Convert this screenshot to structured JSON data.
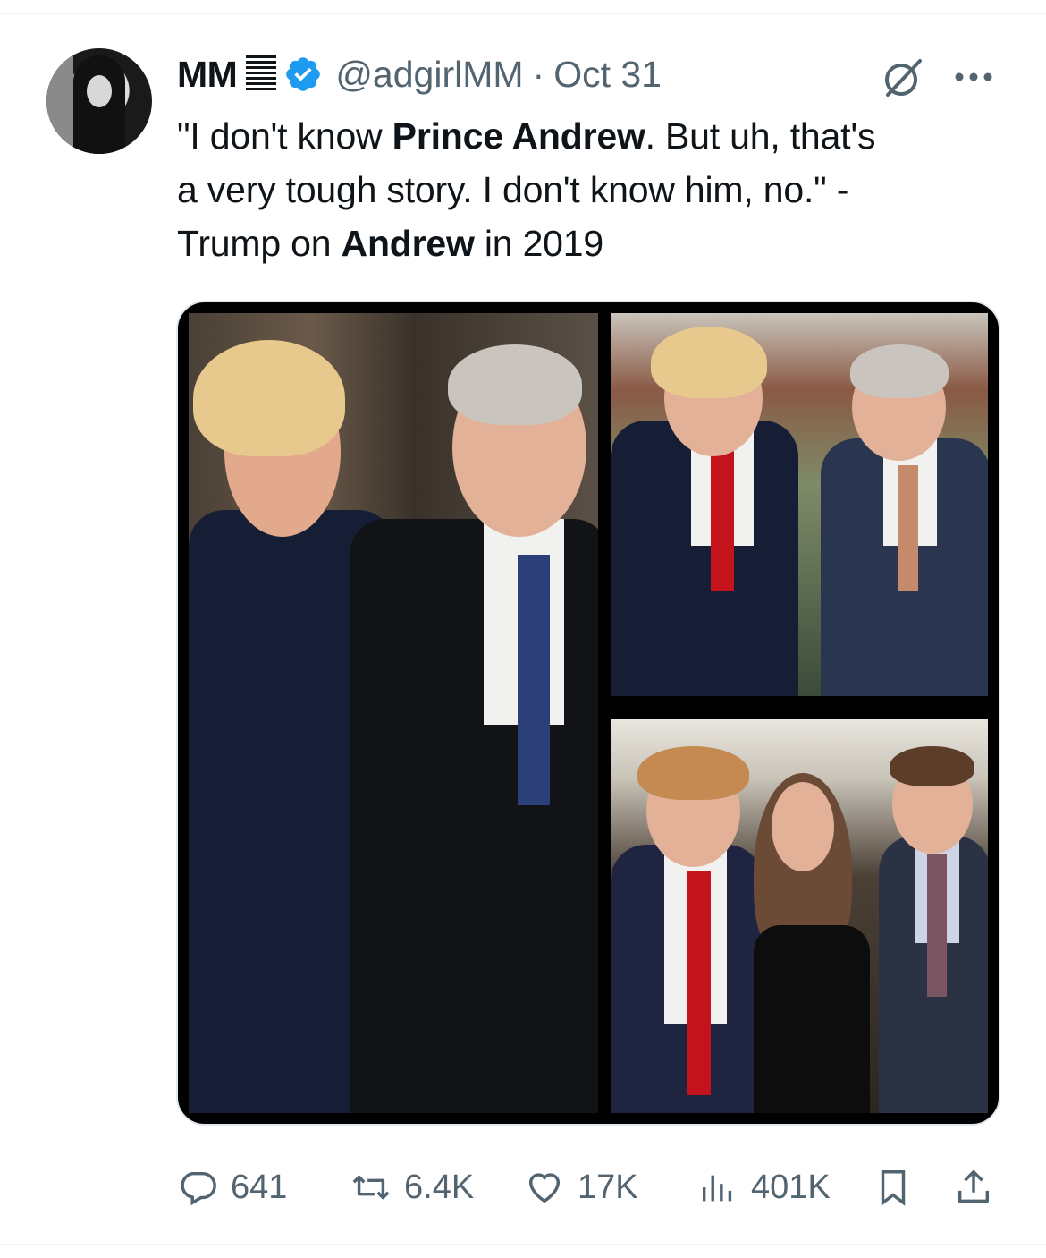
{
  "author": {
    "name": "MM",
    "handle": "@adgirlMM",
    "separator": "·",
    "date": "Oct 31"
  },
  "tweet": {
    "line1_a": "\"I don't know ",
    "line1_b": "Prince Andrew",
    "line1_c": ". But uh, that's",
    "line2": "a very tough story. I don't know him, no.\" -",
    "line3_a": "Trump on ",
    "line3_b": "Andrew",
    "line3_c": " in 2019"
  },
  "actions": {
    "replies": "641",
    "reposts": "6.4K",
    "likes": "17K",
    "views": "401K"
  },
  "icons": {
    "verified": "verified-badge-icon",
    "grok": "grok-icon",
    "more": "more-icon",
    "reply": "reply-icon",
    "repost": "repost-icon",
    "like": "heart-icon",
    "views": "views-icon",
    "bookmark": "bookmark-icon",
    "share": "share-icon"
  },
  "colors": {
    "verified": "#1d9bf0",
    "muted": "#536471",
    "text": "#0f1419"
  }
}
